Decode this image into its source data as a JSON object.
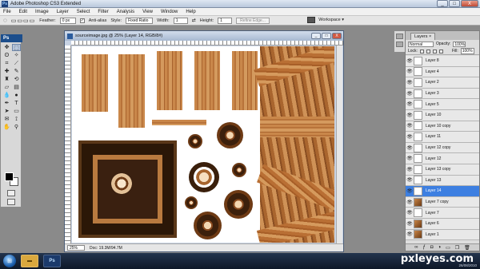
{
  "app": {
    "title": "Adobe Photoshop CS3 Extended",
    "window_controls": [
      "_",
      "□",
      "X"
    ]
  },
  "menu": [
    "File",
    "Edit",
    "Image",
    "Layer",
    "Select",
    "Filter",
    "Analysis",
    "View",
    "Window",
    "Help"
  ],
  "options": {
    "feather_label": "Feather:",
    "feather_value": "0 px",
    "antialias_label": "Anti-alias",
    "style_label": "Style:",
    "style_value": "Fixed Ratio",
    "width_label": "Width:",
    "width_value": "1",
    "height_label": "Height:",
    "height_value": "1",
    "refine_edge": "Refine Edge...",
    "workspace": "Workspace ▾"
  },
  "toolbox": {
    "header": "Ps"
  },
  "document": {
    "title": "sourceimage.jpg @ 25% (Layer 14, RGB/8#)",
    "zoom": "25%",
    "doc_size": "Doc: 19.3M/94.7M",
    "canvas_bg": "#ffffff"
  },
  "layers_panel": {
    "tab": "Layers ×",
    "blend_mode": "Normal",
    "opacity_label": "Opacity:",
    "opacity_value": "100%",
    "lock_label": "Lock:",
    "fill_label": "Fill:",
    "fill_value": "100%",
    "active_color": "#3d7fe1",
    "items": [
      {
        "name": "Layer 8",
        "thumb": "blank"
      },
      {
        "name": "Layer 4",
        "thumb": "blank"
      },
      {
        "name": "Layer 2",
        "thumb": "blank"
      },
      {
        "name": "Layer 3",
        "thumb": "blank"
      },
      {
        "name": "Layer 5",
        "thumb": "blank"
      },
      {
        "name": "Layer 10",
        "thumb": "blank"
      },
      {
        "name": "Layer 10 copy",
        "thumb": "blank"
      },
      {
        "name": "Layer 11",
        "thumb": "blank"
      },
      {
        "name": "Layer 12 copy",
        "thumb": "blank"
      },
      {
        "name": "Layer 12",
        "thumb": "blank"
      },
      {
        "name": "Layer 13 copy",
        "thumb": "blank"
      },
      {
        "name": "Layer 13",
        "thumb": "blank"
      },
      {
        "name": "Layer 14",
        "thumb": "blank",
        "active": true
      },
      {
        "name": "Layer 7 copy",
        "thumb": "image"
      },
      {
        "name": "Layer 7",
        "thumb": "blank"
      },
      {
        "name": "Layer 6",
        "thumb": "image"
      },
      {
        "name": "Layer 1",
        "thumb": "image"
      }
    ]
  },
  "taskbar": {
    "start_icon": "windows-orb-icon",
    "ps_label": "Ps"
  },
  "watermark": {
    "text": "pxleyes.com",
    "date": "26/08/2010"
  }
}
